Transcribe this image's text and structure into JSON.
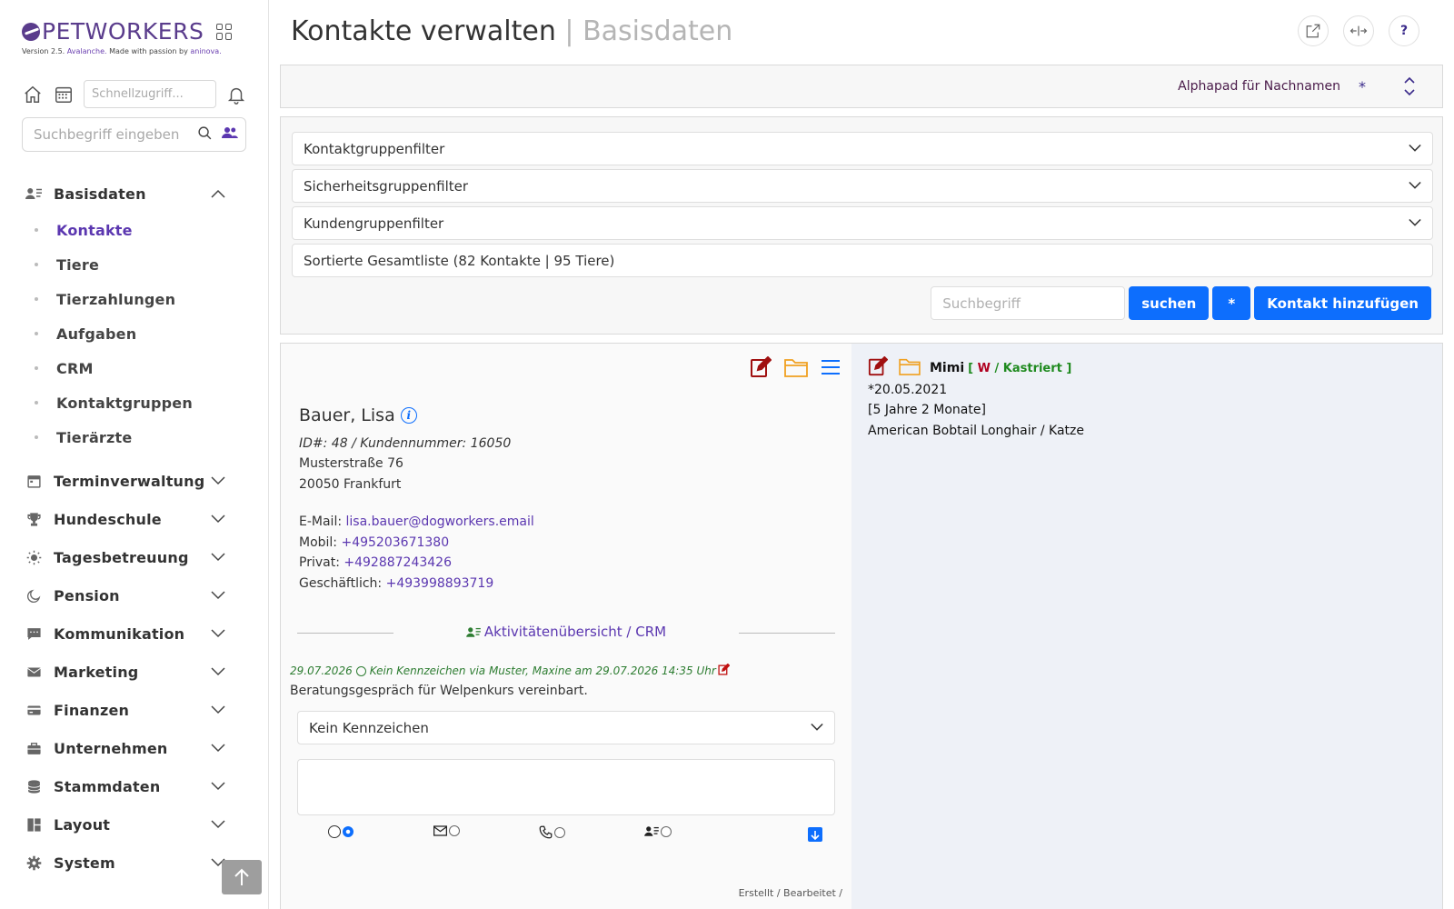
{
  "brand": {
    "name": "PETWORKERS",
    "version_prefix": "Version 2.5.",
    "version_release": "Avalanche.",
    "version_made": "Made with passion by",
    "version_company": "aninova."
  },
  "quick": {
    "placeholder": "Schnellzugriff..."
  },
  "search": {
    "placeholder": "Suchbegriff eingeben"
  },
  "nav": {
    "basisdaten": "Basisdaten",
    "sub": [
      "Kontakte",
      "Tiere",
      "Tierzahlungen",
      "Aufgaben",
      "CRM",
      "Kontaktgruppen",
      "Tierärzte"
    ],
    "groups": [
      "Terminverwaltung",
      "Hundeschule",
      "Tagesbetreuung",
      "Pension",
      "Kommunikation",
      "Marketing",
      "Finanzen",
      "Unternehmen",
      "Stammdaten",
      "Layout",
      "System"
    ]
  },
  "header": {
    "title": "Kontakte verwalten",
    "separator": "|",
    "subtitle": "Basisdaten",
    "help": "?"
  },
  "alphapad": {
    "label": "Alphapad für Nachnamen",
    "star": "*"
  },
  "filters": {
    "contact_group": "Kontaktgruppenfilter",
    "security_group": "Sicherheitsgruppenfilter",
    "customer_group": "Kundengruppenfilter",
    "sorted_list": "Sortierte Gesamtliste (82 Kontakte | 95 Tiere)",
    "search_placeholder": "Suchbegriff",
    "search_button": "suchen",
    "star_button": "*",
    "add_button": "Kontakt hinzufügen"
  },
  "contact": {
    "name": "Bauer, Lisa",
    "ids": "ID#: 48 / Kundennummer: 16050",
    "street": "Musterstraße 76",
    "city": "20050 Frankfurt",
    "email_label": "E-Mail:",
    "email": "lisa.bauer@dogworkers.email",
    "mobile_label": "Mobil:",
    "mobile": "+495203671380",
    "private_label": "Privat:",
    "private": "+492887243426",
    "business_label": "Geschäftlich:",
    "business": "+493998893719",
    "crm_link": "Aktivitätenübersicht / CRM"
  },
  "activity": {
    "date": "29.07.2026",
    "meta": "Kein Kennzeichen via Muster, Maxine am 29.07.2026 14:35 Uhr",
    "text": "Beratungsgespräch für Welpenkurs vereinbart.",
    "select_value": "Kein Kennzeichen",
    "footer": "Erstellt / Bearbeitet /"
  },
  "pet": {
    "name": "Mimi",
    "open_bracket": "[",
    "sex": "W",
    "slash": "/",
    "status": "Kastriert",
    "close_bracket": "]",
    "birth": "*20.05.2021",
    "age": "[5 Jahre 2 Monate]",
    "breed": "American Bobtail Longhair / Katze"
  }
}
